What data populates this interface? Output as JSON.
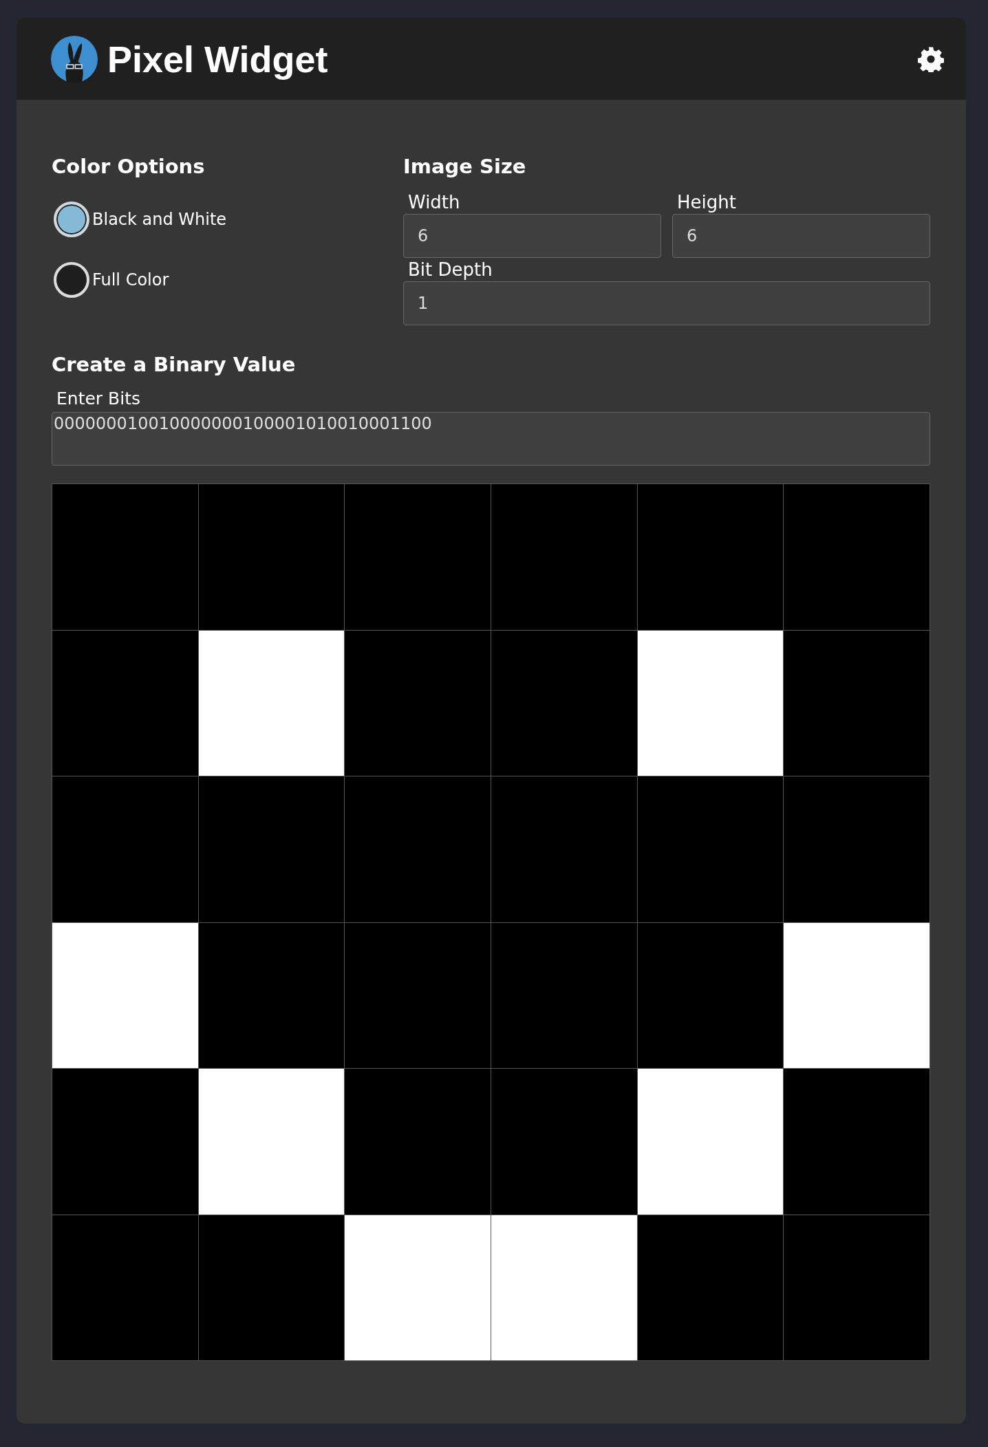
{
  "header": {
    "title": "Pixel Widget"
  },
  "color_options": {
    "heading": "Color Options",
    "options": [
      {
        "label": "Black and White",
        "selected": true
      },
      {
        "label": "Full Color",
        "selected": false
      }
    ]
  },
  "image_size": {
    "heading": "Image Size",
    "fields": [
      {
        "label": "Width",
        "value": "6"
      },
      {
        "label": "Height",
        "value": "6"
      },
      {
        "label": "Bit Depth",
        "value": "1"
      }
    ]
  },
  "binary": {
    "heading": "Create a Binary Value",
    "label": "Enter Bits",
    "value": "000000010010000000100001010010001100"
  }
}
